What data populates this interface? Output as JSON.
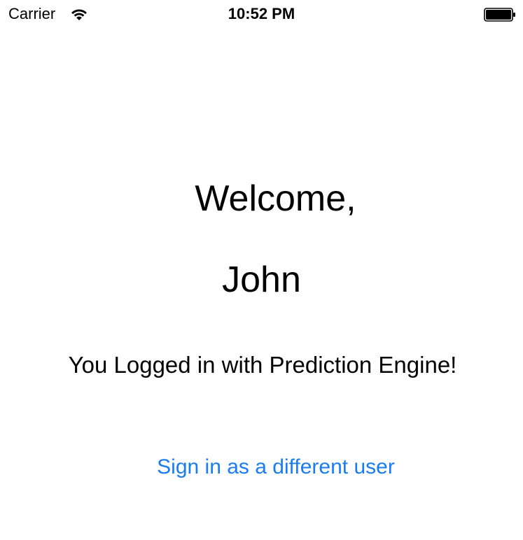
{
  "status_bar": {
    "carrier": "Carrier",
    "time": "10:52 PM",
    "wifi_icon": "wifi-icon",
    "battery_icon": "battery-icon"
  },
  "main": {
    "welcome_text": "Welcome,",
    "user_name": "John",
    "login_message": "You Logged in with Prediction Engine!",
    "signin_link_label": "Sign in as a different user"
  },
  "colors": {
    "background": "#ffffff",
    "text": "#000000",
    "link": "#1a7cf5"
  }
}
